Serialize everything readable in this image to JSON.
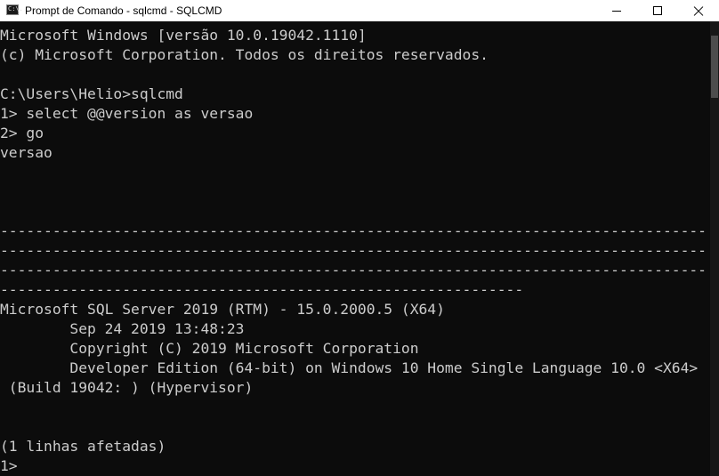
{
  "window": {
    "title": "Prompt de Comando - sqlcmd - SQLCMD",
    "icon_label": "C:\\."
  },
  "console": {
    "lines": [
      "Microsoft Windows [versão 10.0.19042.1110]",
      "(c) Microsoft Corporation. Todos os direitos reservados.",
      "",
      "C:\\Users\\Helio>sqlcmd",
      "1> select @@version as versao",
      "2> go",
      "versao",
      "",
      "",
      "",
      "---------------------------------------------------------------------------------",
      "---------------------------------------------------------------------------------",
      "---------------------------------------------------------------------------------",
      "------------------------------------------------------------",
      "Microsoft SQL Server 2019 (RTM) - 15.0.2000.5 (X64)",
      "        Sep 24 2019 13:48:23",
      "        Copyright (C) 2019 Microsoft Corporation",
      "        Developer Edition (64-bit) on Windows 10 Home Single Language 10.0 <X64>",
      " (Build 19042: ) (Hypervisor)",
      "",
      "",
      "(1 linhas afetadas)",
      "1>"
    ]
  },
  "colors": {
    "console_background": "#0c0c0c",
    "console_text": "#cccccc",
    "titlebar_background": "#ffffff"
  },
  "icons": {
    "app": "command-prompt-icon",
    "minimize": "minimize-icon",
    "maximize": "maximize-icon",
    "close": "close-icon"
  }
}
